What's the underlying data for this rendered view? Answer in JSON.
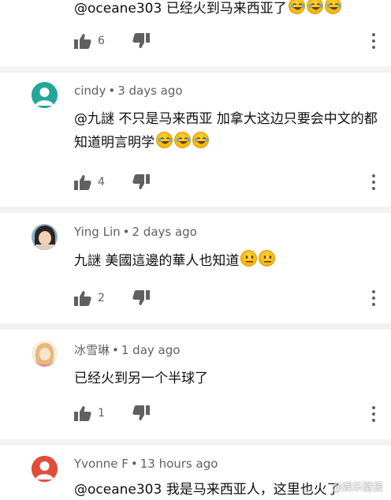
{
  "comments": [
    {
      "text": "@oceane303 已经火到马来西亚了",
      "emojis": 3,
      "likes": "6"
    },
    {
      "author": "cindy",
      "time": "3 days ago",
      "avatar_letter": "",
      "avatar_color": "#26a69a",
      "text": "@九謎 不只是马来西亚 加拿大这边只要会中文的都知道明言明学",
      "emojis": 3,
      "likes": "4"
    },
    {
      "author": "Ying Lin",
      "time": "2 days ago",
      "text": "九謎 美國這邊的華人也知道",
      "emojis": 2,
      "likes": "2"
    },
    {
      "author": "冰雪琳",
      "time": "1 day ago",
      "text": "已经火到另一个半球了",
      "likes": "1"
    },
    {
      "author": "Yvonne F",
      "time": "13 hours ago",
      "avatar_letter": "",
      "avatar_color": "#e04e39",
      "text": "@oceane303 我是马来西亚人，这里也火了"
    }
  ],
  "separator": "•",
  "watermark": "@娱乐壁报"
}
